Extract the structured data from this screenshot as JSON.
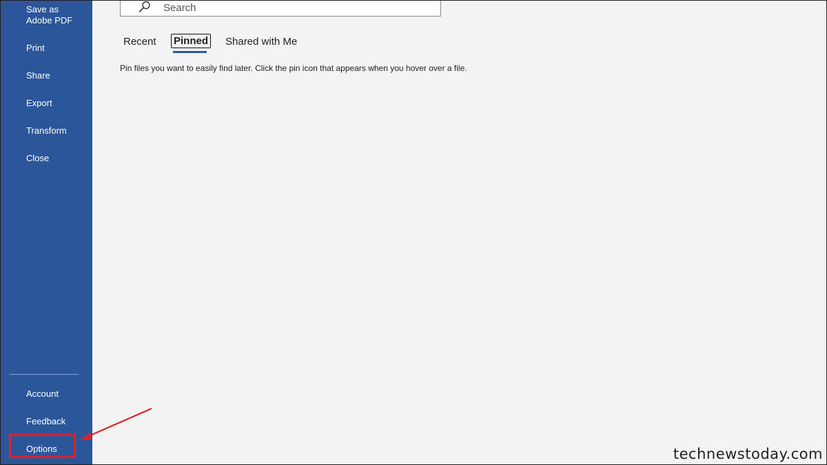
{
  "sidebar": {
    "top_items": [
      {
        "label": "Save as Adobe PDF"
      },
      {
        "label": "Print"
      },
      {
        "label": "Share"
      },
      {
        "label": "Export"
      },
      {
        "label": "Transform"
      },
      {
        "label": "Close"
      }
    ],
    "bottom_items": [
      {
        "label": "Account"
      },
      {
        "label": "Feedback"
      },
      {
        "label": "Options"
      }
    ],
    "background": "#2b579a"
  },
  "search": {
    "placeholder": "Search",
    "icon": "search-icon"
  },
  "tabs": [
    {
      "label": "Recent",
      "selected": false
    },
    {
      "label": "Pinned",
      "selected": true
    },
    {
      "label": "Shared with Me",
      "selected": false
    }
  ],
  "pinned_hint": "Pin files you want to easily find later. Click the pin icon that appears when you hover over a file.",
  "annotation": {
    "highlight_color": "#e32028",
    "target": "Options"
  },
  "watermark": "technewstoday.com"
}
